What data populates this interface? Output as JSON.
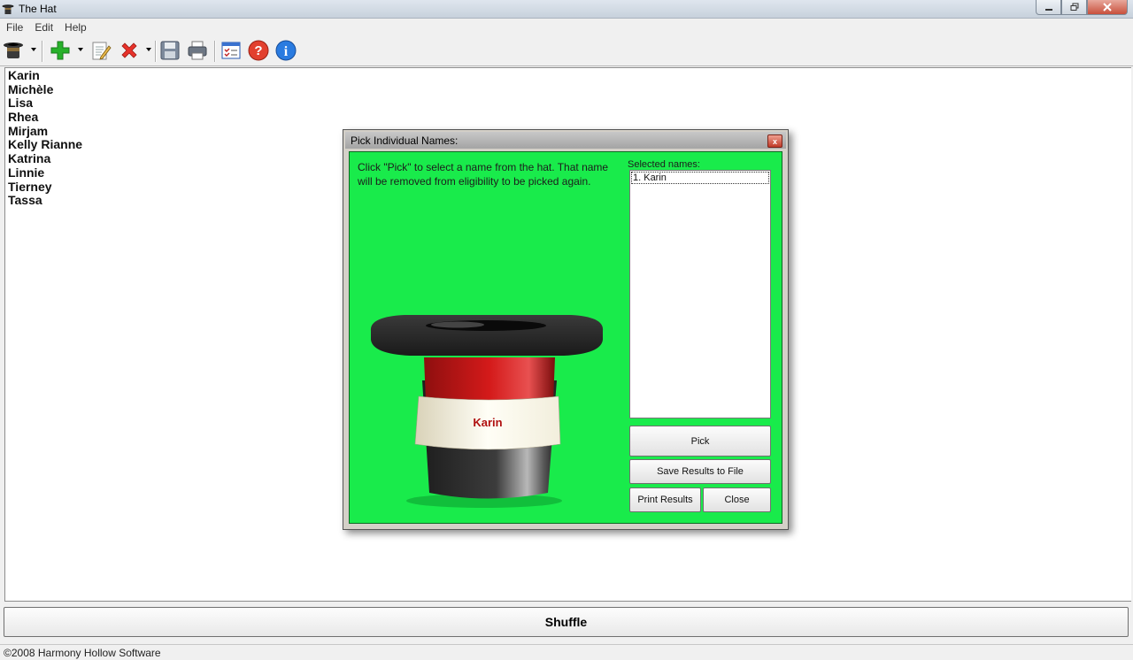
{
  "window": {
    "title": "The Hat"
  },
  "menu": {
    "items": [
      "File",
      "Edit",
      "Help"
    ]
  },
  "toolbar": {
    "icons": [
      "hat-icon",
      "add-icon",
      "edit-icon",
      "delete-icon",
      "save-icon",
      "print-icon",
      "checklist-icon",
      "help-icon",
      "info-icon"
    ]
  },
  "names": [
    "Karin",
    "Michèle",
    "Lisa",
    "Rhea",
    "Mirjam",
    "Kelly Rianne",
    "Katrina",
    "Linnie",
    "Tierney",
    "Tassa"
  ],
  "shuffle_label": "Shuffle",
  "status": {
    "text": "©2008 Harmony Hollow Software"
  },
  "dialog": {
    "title": "Pick Individual Names:",
    "close_glyph": "x",
    "instructions": "Click \"Pick\" to select a name from the hat. That name will be removed from eligibility to be picked again.",
    "selected_label": "Selected names:",
    "selected": [
      "1. Karin"
    ],
    "hat_name": "Karin",
    "buttons": {
      "pick": "Pick",
      "save": "Save Results to File",
      "print": "Print Results",
      "close": "Close"
    },
    "colors": {
      "background": "#19eb4b",
      "hat_band": "#d41a1a",
      "name_text": "#b01010"
    }
  }
}
